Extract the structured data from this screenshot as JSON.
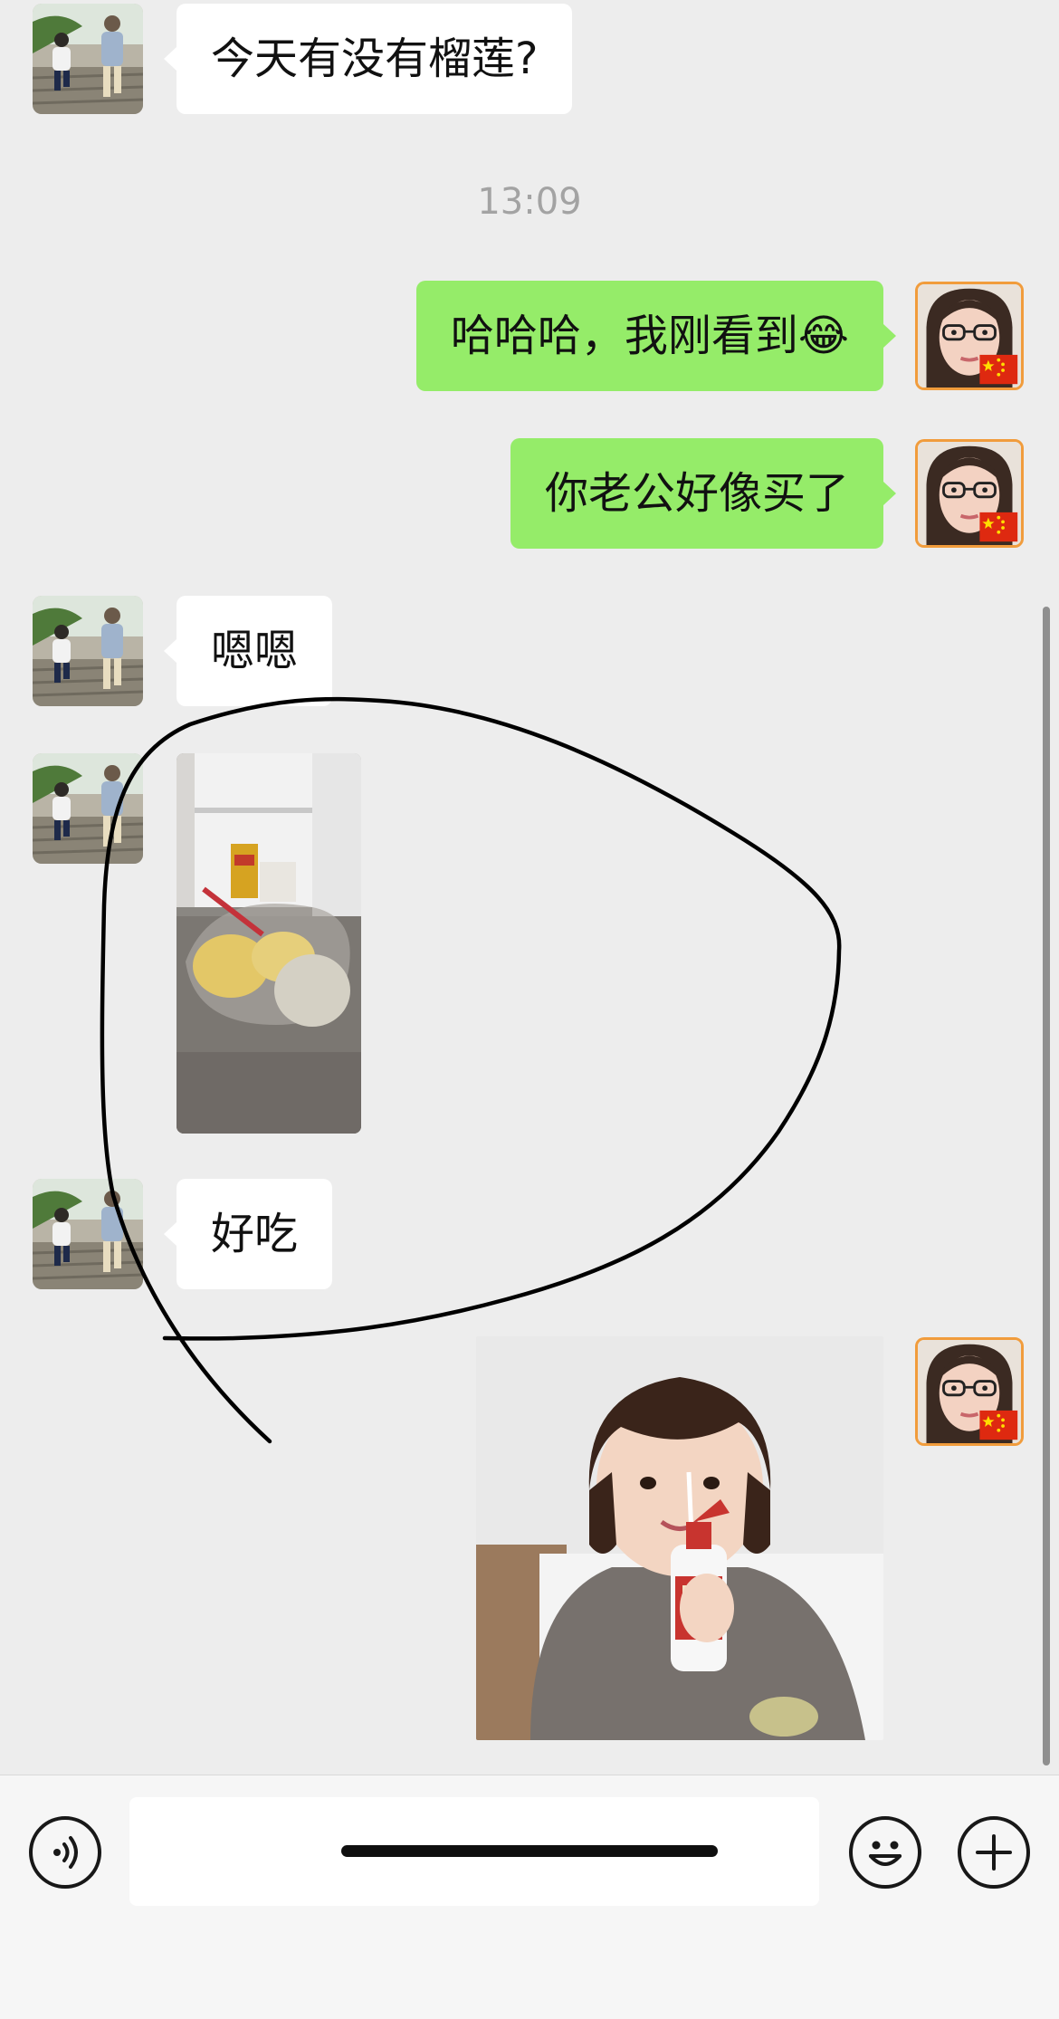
{
  "timestamp": "13:09",
  "messages": [
    {
      "side": "incoming",
      "type": "text",
      "text": "今天有没有榴莲?"
    },
    {
      "side": "outgoing",
      "type": "text",
      "text": "哈哈哈，我刚看到",
      "emoji": "😂"
    },
    {
      "side": "outgoing",
      "type": "text",
      "text": "你老公好像买了"
    },
    {
      "side": "incoming",
      "type": "text",
      "text": "嗯嗯"
    },
    {
      "side": "incoming",
      "type": "image",
      "icon": "durian-photo"
    },
    {
      "side": "incoming",
      "type": "text",
      "text": "好吃"
    },
    {
      "side": "outgoing",
      "type": "image",
      "icon": "girl-with-bottle-sticker"
    }
  ],
  "colors": {
    "background": "#ededed",
    "incoming_bubble": "#ffffff",
    "outgoing_bubble": "#95ec69",
    "timestamp": "#a3a3a3",
    "input_bar": "#f6f6f6",
    "annotation_stroke": "#000000"
  },
  "input_bar": {
    "voice_icon": "voice-icon",
    "text_value": "",
    "emoji_icon": "smile-icon",
    "more_icon": "plus-icon"
  }
}
